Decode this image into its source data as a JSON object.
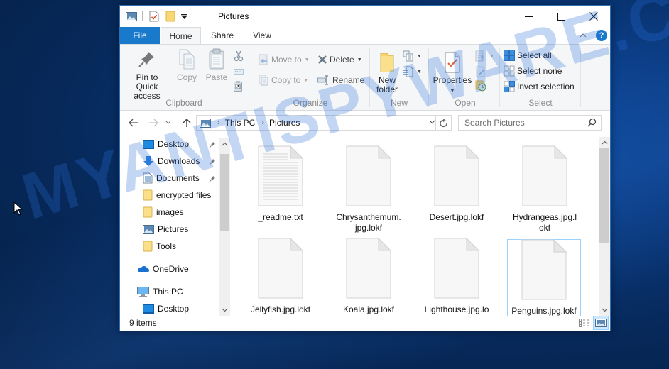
{
  "window": {
    "title": "Pictures",
    "controls": {
      "minimize": "minimize",
      "maximize": "maximize",
      "close": "close"
    }
  },
  "ribbon_tabs": [
    {
      "label": "File",
      "active": false
    },
    {
      "label": "Home",
      "active": true
    },
    {
      "label": "Share",
      "active": false
    },
    {
      "label": "View",
      "active": false
    }
  ],
  "help_label": "?",
  "ribbon": {
    "clipboard": {
      "label": "Clipboard",
      "pin": "Pin to Quick access",
      "pin_line1": "Pin to Quick",
      "pin_line2": "access",
      "copy": "Copy",
      "paste": "Paste"
    },
    "organize": {
      "label": "Organize",
      "move_to": "Move to",
      "copy_to": "Copy to",
      "delete": "Delete",
      "rename": "Rename"
    },
    "new": {
      "label": "New",
      "new_folder_line1": "New",
      "new_folder_line2": "folder"
    },
    "open": {
      "label": "Open",
      "properties": "Properties"
    },
    "select": {
      "label": "Select",
      "select_all": "Select all",
      "select_none": "Select none",
      "invert_selection": "Invert selection"
    }
  },
  "address_bar": {
    "breadcrumbs": [
      "This PC",
      "Pictures"
    ]
  },
  "search": {
    "placeholder": "Search Pictures"
  },
  "nav_pane": {
    "items": [
      {
        "label": "Desktop",
        "icon": "desktop-icon",
        "pinned": true
      },
      {
        "label": "Downloads",
        "icon": "download-arrow-icon",
        "pinned": true
      },
      {
        "label": "Documents",
        "icon": "documents-icon",
        "pinned": true
      },
      {
        "label": "encrypted files",
        "icon": "folder-icon",
        "pinned": false
      },
      {
        "label": "images",
        "icon": "folder-icon",
        "pinned": false
      },
      {
        "label": "Pictures",
        "icon": "pictures-icon",
        "pinned": false
      },
      {
        "label": "Tools",
        "icon": "folder-icon",
        "pinned": false
      },
      {
        "label": "OneDrive",
        "icon": "cloud-icon",
        "pinned": false
      },
      {
        "label": "This PC",
        "icon": "computer-icon",
        "pinned": false
      },
      {
        "label": "Desktop",
        "icon": "desktop-icon",
        "pinned": false
      }
    ]
  },
  "files": [
    {
      "name": "_readme.txt",
      "type": "text",
      "selected": false
    },
    {
      "name": "Chrysanthemum.jpg.lokf",
      "type": "blank",
      "selected": false
    },
    {
      "name": "Desert.jpg.lokf",
      "type": "blank",
      "selected": false
    },
    {
      "name": "Hydrangeas.jpg.lokf",
      "type": "blank",
      "selected": false
    },
    {
      "name": "Jellyfish.jpg.lokf",
      "type": "blank",
      "selected": false
    },
    {
      "name": "Koala.jpg.lokf",
      "type": "blank",
      "selected": false
    },
    {
      "name": "Lighthouse.jpg.lo",
      "type": "blank",
      "selected": false
    },
    {
      "name": "Penguins.jpg.lokf",
      "type": "blank",
      "selected": true
    }
  ],
  "files_display": {
    "chrysanthemum_line1": "Chrysanthemum.",
    "chrysanthemum_line2": "jpg.lokf",
    "hydrangeas_line1": "Hydrangeas.jpg.l",
    "hydrangeas_line2": "okf"
  },
  "status_bar": {
    "item_count": "9 items"
  },
  "watermark": "MYANTISPYWARE.COM",
  "colors": {
    "accent": "#1979ca",
    "selection_border": "#99d1ff",
    "selection_fill": "#cce8ff",
    "desktop_bg": "#0a3a80"
  }
}
